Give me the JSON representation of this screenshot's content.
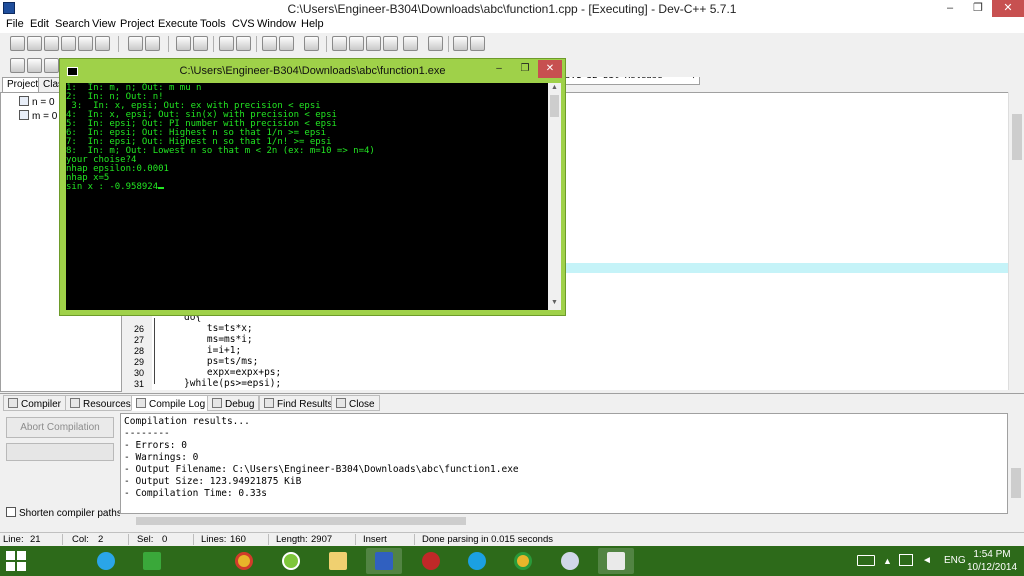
{
  "ide": {
    "title": "C:\\Users\\Engineer-B304\\Downloads\\abc\\function1.cpp - [Executing] - Dev-C++ 5.7.1",
    "window_buttons": {
      "minimize": "–",
      "maximize": "❐",
      "close": "✕"
    }
  },
  "menu": [
    "File",
    "Edit",
    "Search",
    "View",
    "Project",
    "Execute",
    "Tools",
    "CVS",
    "Window",
    "Help"
  ],
  "toolbar": {
    "compiler": "MinGW GCC 4.8.1 32-bit Release"
  },
  "left_panel": {
    "tabs": [
      "Project",
      "Clas"
    ],
    "tree": [
      "n = 0",
      "m = 0"
    ]
  },
  "editor": {
    "lines": [
      {
        "no": "",
        "code": "do{"
      },
      {
        "no": "26",
        "code": "    ts=ts*x;"
      },
      {
        "no": "27",
        "code": "    ms=ms*i;"
      },
      {
        "no": "28",
        "code": "    i=i+1;"
      },
      {
        "no": "29",
        "code": "    ps=ts/ms;"
      },
      {
        "no": "30",
        "code": "    expx=expx+ps;"
      },
      {
        "no": "31",
        "code": "}while(ps>=epsi);"
      }
    ]
  },
  "bottom_tabs": [
    "Compiler",
    "Resources",
    "Compile Log",
    "Debug",
    "Find Results",
    "Close"
  ],
  "compile_log": {
    "abort_button": "Abort Compilation",
    "shorten_paths": "Shorten compiler paths",
    "lines": [
      "Compilation results...",
      "--------",
      "- Errors: 0",
      "- Warnings: 0",
      "- Output Filename: C:\\Users\\Engineer-B304\\Downloads\\abc\\function1.exe",
      "- Output Size: 123.94921875 KiB",
      "- Compilation Time: 0.33s"
    ]
  },
  "status": {
    "line_label": "Line:",
    "line_value": "21",
    "col_label": "Col:",
    "col_value": "2",
    "sel_label": "Sel:",
    "sel_value": "0",
    "lines_label": "Lines:",
    "lines_value": "160",
    "length_label": "Length:",
    "length_value": "2907",
    "mode": "Insert",
    "parse": "Done parsing in 0.015 seconds"
  },
  "console": {
    "title": "C:\\Users\\Engineer-B304\\Downloads\\abc\\function1.exe",
    "lines": [
      "1:  In: m, n; Out: m mu n",
      "2:  In: n; Out: n!",
      " 3:  In: x, epsi; Out: ex with precision < epsi",
      "4:  In: x, epsi; Out: sin(x) with precision < epsi",
      "5:  In: epsi; Out: PI number with precision < epsi",
      "6:  In: epsi; Out: Highest n so that 1/n >= epsi",
      "7:  In: epsi; Out: Highest n so that 1/n! >= epsi",
      "8:  In: m; Out: Lowest n so that m < 2n (ex: m=10 => n=4)",
      "your choise?4",
      "nhap epsilon:0.0001",
      "nhap x=5",
      "sin x : -0.958924"
    ]
  },
  "taskbar": {
    "language": "ENG",
    "time": "1:54 PM",
    "date": "10/12/2014"
  },
  "colors": {
    "console_frame": "#9fd149",
    "console_text": "#22e522",
    "taskbar": "#2d6a1a",
    "close_button": "#c75050"
  }
}
